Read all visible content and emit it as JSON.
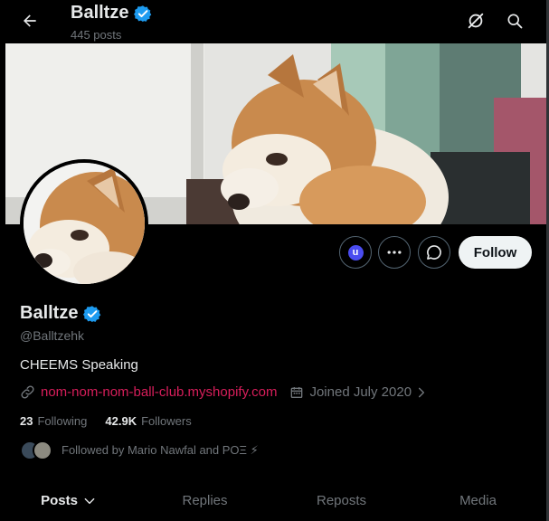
{
  "header": {
    "name": "Balltze",
    "posts_count": "445 posts",
    "icons": {
      "back": "arrow-left-icon",
      "grok": "slashed-circle-icon",
      "search": "search-icon"
    }
  },
  "profile": {
    "display_name": "Balltze",
    "verified_icon": "verified-badge-icon",
    "handle": "@Balltzehk",
    "bio": "CHEEMS Speaking",
    "link_icon": "link-icon",
    "website": "nom-nom-nom-ball-club.myshopify.com",
    "calendar_icon": "calendar-icon",
    "joined": "Joined July 2020",
    "following_count": "23",
    "following_label": "Following",
    "followers_count": "42.9K",
    "followers_label": "Followers",
    "followed_by": "Followed by Mario Nawfal and POΞ ⚡"
  },
  "actions": {
    "u_label": "u",
    "more_icon": "more-icon",
    "message_icon": "message-icon",
    "follow_label": "Follow"
  },
  "tabs": [
    {
      "label": "Posts",
      "active": true
    },
    {
      "label": "Replies",
      "active": false
    },
    {
      "label": "Reposts",
      "active": false
    },
    {
      "label": "Media",
      "active": false
    }
  ],
  "colors": {
    "background": "#000000",
    "text": "#e7e9ea",
    "muted": "#71767b",
    "verified": "#1d9bf0",
    "link": "#d81e5b",
    "follow_bg": "#eff3f4"
  }
}
